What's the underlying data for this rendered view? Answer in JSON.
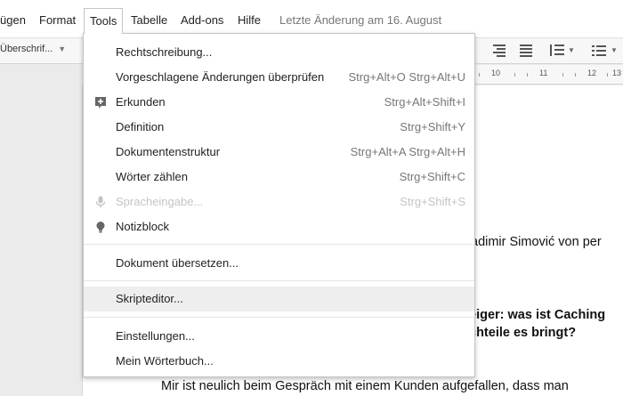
{
  "menubar": {
    "items": [
      "ügen",
      "Format",
      "Tools",
      "Tabelle",
      "Add-ons",
      "Hilfe"
    ],
    "last_edit": "Letzte Änderung am 16. August"
  },
  "toolbar": {
    "style_select": "Überschrif..."
  },
  "ruler": {
    "labels": [
      "10",
      "11",
      "12",
      "13"
    ]
  },
  "document": {
    "line1": "adimir Simović von per",
    "heading_line1": "eiger: was ist Caching",
    "heading_line2": "chteile es bringt?",
    "line_last": "Mir ist neulich beim Gespräch mit einem Kunden aufgefallen, dass man"
  },
  "tools_menu": {
    "items": [
      {
        "label": "Rechtschreibung...",
        "shortcut": ""
      },
      {
        "label": "Vorgeschlagene Änderungen überprüfen",
        "shortcut": "Strg+Alt+O Strg+Alt+U"
      },
      {
        "label": "Erkunden",
        "shortcut": "Strg+Alt+Shift+I",
        "icon": "explore-plus-icon"
      },
      {
        "label": "Definition",
        "shortcut": "Strg+Shift+Y"
      },
      {
        "label": "Dokumentenstruktur",
        "shortcut": "Strg+Alt+A Strg+Alt+H"
      },
      {
        "label": "Wörter zählen",
        "shortcut": "Strg+Shift+C"
      },
      {
        "label": "Spracheingabe...",
        "shortcut": "Strg+Shift+S",
        "icon": "microphone-icon",
        "disabled": true
      },
      {
        "label": "Notizblock",
        "shortcut": "",
        "icon": "lightbulb-icon"
      },
      {
        "label": "Dokument übersetzen...",
        "shortcut": ""
      },
      {
        "label": "Skripteditor...",
        "shortcut": "",
        "hover": true
      },
      {
        "label": "Einstellungen...",
        "shortcut": ""
      },
      {
        "label": "Mein Wörterbuch...",
        "shortcut": ""
      }
    ]
  },
  "colors": {
    "hover_bg": "#eeeeee",
    "disabled_text": "#c4c4c4",
    "icon_gray": "#666666"
  }
}
